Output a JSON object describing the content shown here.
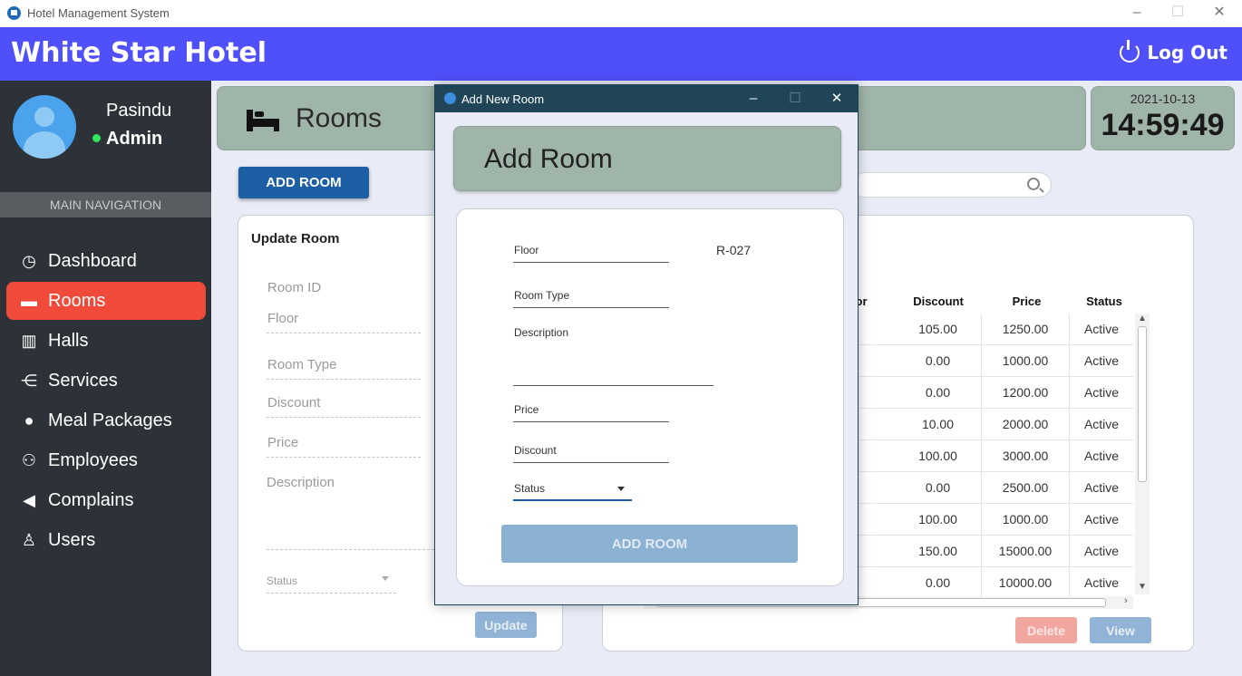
{
  "window": {
    "title": "Hotel Management System"
  },
  "header": {
    "hotel_name": "White Star Hotel",
    "logout_label": "Log Out"
  },
  "user": {
    "name": "Pasindu",
    "role": "Admin"
  },
  "sidebar": {
    "section_title": "MAIN NAVIGATION",
    "items": [
      {
        "label": "Dashboard",
        "icon": "dashboard-icon",
        "glyph": "◷"
      },
      {
        "label": "Rooms",
        "icon": "bed-icon",
        "glyph": "▬"
      },
      {
        "label": "Halls",
        "icon": "halls-icon",
        "glyph": "▥"
      },
      {
        "label": "Services",
        "icon": "services-icon",
        "glyph": "⋲"
      },
      {
        "label": "Meal Packages",
        "icon": "meal-icon",
        "glyph": "●"
      },
      {
        "label": "Employees",
        "icon": "employees-icon",
        "glyph": "⚇"
      },
      {
        "label": "Complains",
        "icon": "megaphone-icon",
        "glyph": "◀"
      },
      {
        "label": "Users",
        "icon": "users-icon",
        "glyph": "♙"
      }
    ],
    "active_index": 1
  },
  "page": {
    "title": "Rooms",
    "add_button": "ADD ROOM",
    "date": "2021-10-13",
    "time": "14:59:49"
  },
  "update_form": {
    "title": "Update Room",
    "fields": [
      "Room ID",
      "Floor",
      "Room Type",
      "Discount",
      "Price",
      "Description"
    ],
    "status_label": "Status",
    "update_button": "Update"
  },
  "table": {
    "columns": [
      "or",
      "Discount",
      "Price",
      "Status"
    ],
    "rows": [
      {
        "discount": "105.00",
        "price": "1250.00",
        "status": "Active"
      },
      {
        "discount": "0.00",
        "price": "1000.00",
        "status": "Active"
      },
      {
        "discount": "0.00",
        "price": "1200.00",
        "status": "Active"
      },
      {
        "discount": "10.00",
        "price": "2000.00",
        "status": "Active"
      },
      {
        "discount": "100.00",
        "price": "3000.00",
        "status": "Active"
      },
      {
        "discount": "0.00",
        "price": "2500.00",
        "status": "Active"
      },
      {
        "discount": "100.00",
        "price": "1000.00",
        "status": "Active"
      },
      {
        "discount": "150.00",
        "price": "15000.00",
        "status": "Active"
      },
      {
        "discount": "0.00",
        "price": "10000.00",
        "status": "Active"
      }
    ],
    "delete_button": "Delete",
    "view_button": "View"
  },
  "modal": {
    "window_title": "Add New Room",
    "header": "Add Room",
    "room_id": "R-027",
    "floor_label": "Floor",
    "room_type_label": "Room Type",
    "description_label": "Description",
    "price_label": "Price",
    "discount_label": "Discount",
    "status_label": "Status",
    "add_button": "ADD ROOM"
  }
}
